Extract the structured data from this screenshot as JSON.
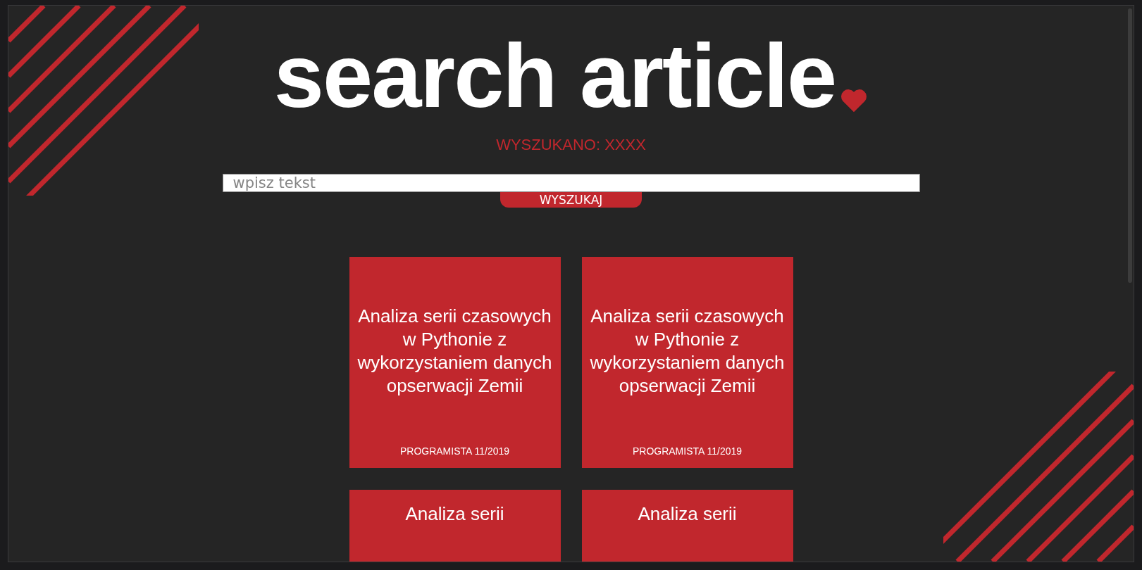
{
  "header": {
    "title": "search article",
    "status": "WYSZUKANO: XXXX"
  },
  "search": {
    "placeholder": "wpisz tekst",
    "button": "WYSZUKAJ"
  },
  "articles": [
    {
      "title": "Analiza serii czasowych w Pythonie z wykorzystaniem danych opserwacji Zemii",
      "source": "PROGRAMISTA 11/2019"
    },
    {
      "title": "Analiza serii czasowych w Pythonie z wykorzystaniem danych opserwacji Zemii",
      "source": "PROGRAMISTA 11/2019"
    },
    {
      "title": "Analiza serii"
    },
    {
      "title": "Analiza serii"
    }
  ]
}
